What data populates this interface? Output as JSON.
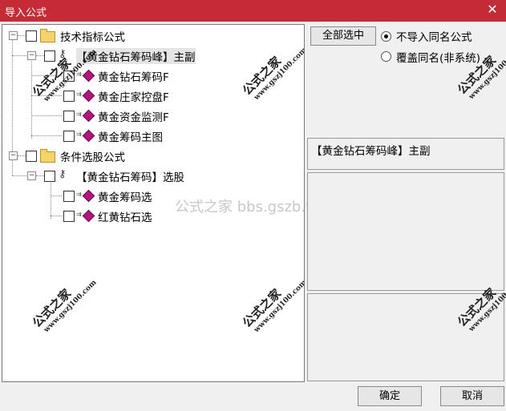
{
  "window": {
    "title": "导入公式",
    "close_icon": "close-icon"
  },
  "tree": {
    "groups": [
      {
        "label": "技术指标公式",
        "expander": "⊟",
        "children": [
          {
            "label": "【黄金钻石筹码峰】主副",
            "expander": "⊟",
            "children": [
              {
                "label": "黄金钻石筹码F"
              },
              {
                "label": "黄金庄家控盘F"
              },
              {
                "label": "黄金资金监测F"
              },
              {
                "label": "黄金筹码主图"
              }
            ]
          }
        ]
      },
      {
        "label": "条件选股公式",
        "expander": "⊟",
        "children": [
          {
            "label": "【黄金钻石筹码】选股",
            "expander": "⊟",
            "children": [
              {
                "label": "黄金筹码选"
              },
              {
                "label": "红黄钻石选"
              }
            ]
          }
        ]
      }
    ]
  },
  "right": {
    "select_all_label": "全部选中",
    "radio_no_import_label": "不导入同名公式",
    "radio_overwrite_label": "覆盖同名(非系统)",
    "selected_name": "【黄金钻石筹码峰】主副"
  },
  "watermark": {
    "brand": "公式之家",
    "url": "www.gszj100.com",
    "center_text": "公式之家 bbs.gszb.top"
  },
  "buttons": {
    "ok_label": "确定",
    "cancel_label": "取消"
  }
}
